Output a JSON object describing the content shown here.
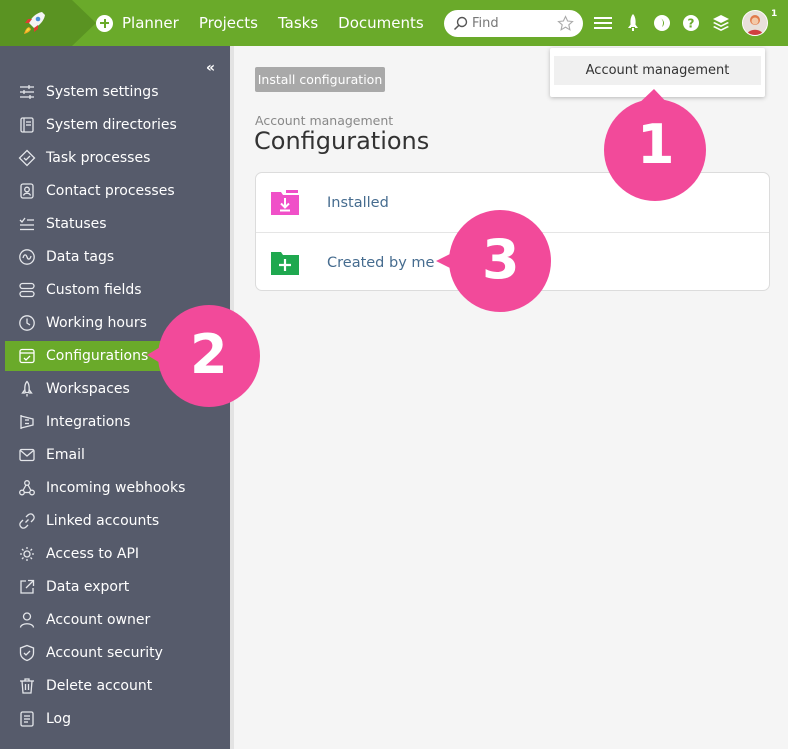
{
  "topbar": {
    "nav": [
      "Planner",
      "Projects",
      "Tasks",
      "Documents"
    ],
    "search_placeholder": "Find",
    "avatar_badge": "1",
    "colors": {
      "brand": "#6aaa2a",
      "brand_dark": "#5a9322"
    },
    "icons": [
      "rocket-logo-icon",
      "plus-circle-icon",
      "search-icon",
      "star-icon",
      "menu-icon",
      "rocket-icon",
      "moon-icon",
      "help-icon",
      "layers-icon",
      "avatar"
    ]
  },
  "dropdown": {
    "item": "Account management"
  },
  "sidebar": {
    "collapse": "«",
    "items": [
      {
        "label": "System settings",
        "icon": "sliders-icon"
      },
      {
        "label": "System directories",
        "icon": "book-icon"
      },
      {
        "label": "Task processes",
        "icon": "diamond-icon"
      },
      {
        "label": "Contact processes",
        "icon": "contact-icon"
      },
      {
        "label": "Statuses",
        "icon": "statuses-icon"
      },
      {
        "label": "Data tags",
        "icon": "tag-icon"
      },
      {
        "label": "Custom fields",
        "icon": "fields-icon"
      },
      {
        "label": "Working hours",
        "icon": "clock-icon"
      },
      {
        "label": "Configurations",
        "icon": "configurations-icon",
        "active": true
      },
      {
        "label": "Workspaces",
        "icon": "rocket-icon"
      },
      {
        "label": "Integrations",
        "icon": "integrations-icon"
      },
      {
        "label": "Email",
        "icon": "mail-icon"
      },
      {
        "label": "Incoming webhooks",
        "icon": "webhook-icon"
      },
      {
        "label": "Linked accounts",
        "icon": "link-icon"
      },
      {
        "label": "Access to API",
        "icon": "api-icon"
      },
      {
        "label": "Data export",
        "icon": "export-icon"
      },
      {
        "label": "Account owner",
        "icon": "user-icon"
      },
      {
        "label": "Account security",
        "icon": "shield-icon"
      },
      {
        "label": "Delete account",
        "icon": "trash-icon"
      },
      {
        "label": "Log",
        "icon": "log-icon"
      }
    ]
  },
  "main": {
    "install_button": "Install configuration",
    "breadcrumb": "Account management",
    "title": "Configurations",
    "rows": [
      {
        "label": "Installed",
        "icon": "folder-download-icon",
        "color": "#f050c8"
      },
      {
        "label": "Created by me",
        "icon": "folder-plus-icon",
        "color": "#1fa84f"
      }
    ]
  },
  "callouts": {
    "color": "#f24a9a",
    "numbers": [
      "1",
      "2",
      "3"
    ]
  }
}
